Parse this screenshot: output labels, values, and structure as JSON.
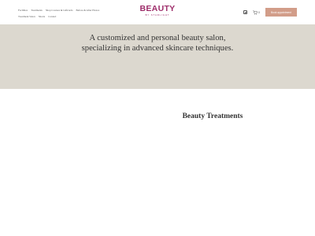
{
  "nav": {
    "row1": [
      "Facilities",
      "Treatments",
      "Shop Courses & Giftcards",
      "Before & After Photos"
    ],
    "row2": [
      "Treatment Salon",
      "Shorts",
      "Contact"
    ]
  },
  "logo": {
    "main": "BEAUTY",
    "sub": "BY STARLIGHT"
  },
  "instagram_icon": "instagram-icon",
  "cart": {
    "icon": "cart-icon",
    "count": "0"
  },
  "book_button": "Book appointment",
  "hero": {
    "text": "A customized and personal  beauty salon, specializing in advanced skincare techniques."
  },
  "section_title": "Beauty Treatments",
  "colors": {
    "brand": "#9e2d6a",
    "button": "#d29d89",
    "hero_bg": "#dcd8cf"
  }
}
